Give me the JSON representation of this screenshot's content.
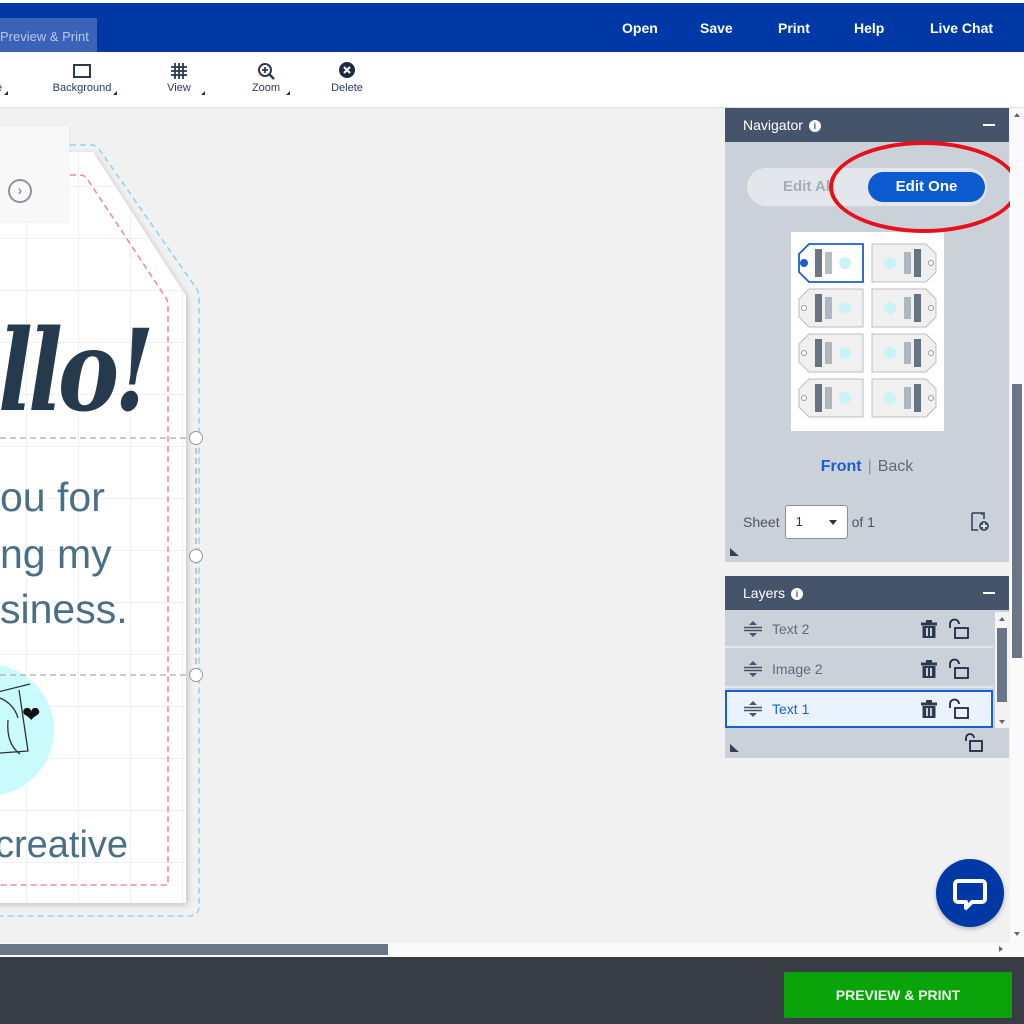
{
  "header": {
    "active_tab": "Preview & Print",
    "menu": [
      "Open",
      "Save",
      "Print",
      "Help",
      "Live Chat"
    ],
    "accent_color": "#0039a6"
  },
  "toolbar": {
    "partial_tool_label": "e",
    "tools": [
      {
        "label": "Background",
        "icon": "rectangle-icon"
      },
      {
        "label": "View",
        "icon": "grid-icon"
      },
      {
        "label": "Zoom",
        "icon": "zoom-in-icon"
      },
      {
        "label": "Delete",
        "icon": "delete-circle-x-icon"
      }
    ]
  },
  "canvas": {
    "headline": "llo!",
    "body_lines": [
      "ou for",
      "ng my",
      "siness."
    ],
    "footer_text": "creative",
    "heart": "❤"
  },
  "navigator": {
    "title": "Navigator",
    "toggle_off": "Edit All",
    "toggle_on": "Edit One",
    "thumbnail_count": 8,
    "selected_thumbnail": 1,
    "front_label": "Front",
    "back_label": "Back",
    "sheet_label": "Sheet",
    "sheet_value": "1",
    "sheet_of": "of 1"
  },
  "layers": {
    "title": "Layers",
    "items": [
      {
        "name": "Text 2",
        "selected": false
      },
      {
        "name": "Image 2",
        "selected": false
      },
      {
        "name": "Text 1",
        "selected": true
      }
    ]
  },
  "footer": {
    "preview_print": "PREVIEW & PRINT",
    "button_color": "#0aa30a"
  },
  "annotation": {
    "color": "#e8101a",
    "target": "Edit One"
  }
}
